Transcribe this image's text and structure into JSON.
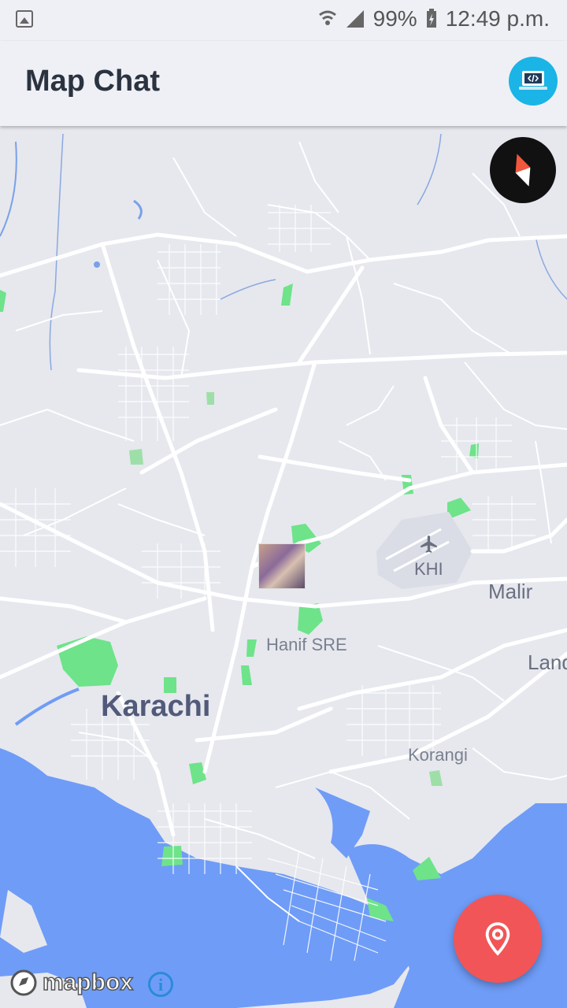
{
  "status_bar": {
    "battery": "99%",
    "time": "12:49 p.m."
  },
  "app_bar": {
    "title": "Map Chat"
  },
  "map": {
    "labels": {
      "city": "Karachi",
      "malir": "Malir",
      "landhi": "Land",
      "korangi": "Korangi",
      "hanif": "Hanif SRE",
      "airport": "KHI"
    }
  },
  "attribution": {
    "logo_text": "mapbox",
    "info_symbol": "i"
  },
  "colors": {
    "water": "#6f9cf7",
    "land": "#e6e8ee",
    "park": "#6ee38a",
    "fab": "#f25557",
    "dev_button": "#1ab4e6"
  }
}
